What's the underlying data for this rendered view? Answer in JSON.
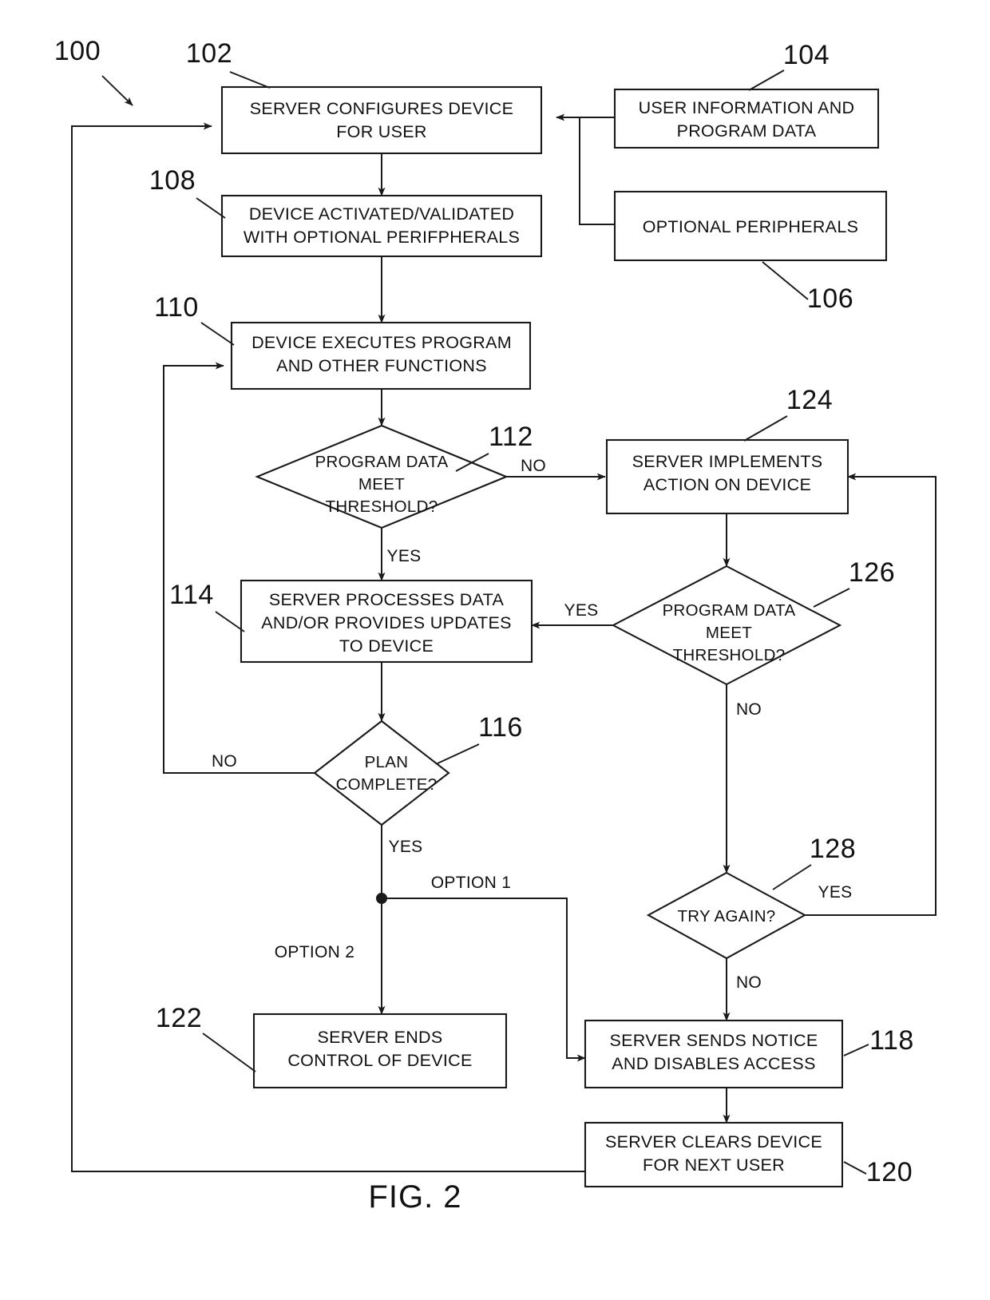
{
  "figure": {
    "caption": "FIG. 2",
    "system_ref": "100"
  },
  "nodes": [
    {
      "id": "102",
      "ref": "102",
      "type": "process",
      "lines": [
        "SERVER CONFIGURES DEVICE",
        "FOR USER"
      ]
    },
    {
      "id": "104",
      "ref": "104",
      "type": "process",
      "lines": [
        "USER INFORMATION AND",
        "PROGRAM DATA"
      ]
    },
    {
      "id": "106",
      "ref": "106",
      "type": "process",
      "lines": [
        "OPTIONAL PERIPHERALS"
      ]
    },
    {
      "id": "108",
      "ref": "108",
      "type": "process",
      "lines": [
        "DEVICE ACTIVATED/VALIDATED",
        "WITH OPTIONAL PERIFPHERALS"
      ]
    },
    {
      "id": "110",
      "ref": "110",
      "type": "process",
      "lines": [
        "DEVICE EXECUTES PROGRAM",
        "AND OTHER FUNCTIONS"
      ]
    },
    {
      "id": "112",
      "ref": "112",
      "type": "decision",
      "lines": [
        "PROGRAM DATA",
        "MEET",
        "THRESHOLD?"
      ]
    },
    {
      "id": "114",
      "ref": "114",
      "type": "process",
      "lines": [
        "SERVER PROCESSES DATA",
        "AND/OR PROVIDES UPDATES",
        "TO DEVICE"
      ]
    },
    {
      "id": "116",
      "ref": "116",
      "type": "decision",
      "lines": [
        "PLAN",
        "COMPLETE?"
      ]
    },
    {
      "id": "118",
      "ref": "118",
      "type": "process",
      "lines": [
        "SERVER SENDS NOTICE",
        "AND DISABLES ACCESS"
      ]
    },
    {
      "id": "120",
      "ref": "120",
      "type": "process",
      "lines": [
        "SERVER CLEARS DEVICE",
        "FOR NEXT USER"
      ]
    },
    {
      "id": "122",
      "ref": "122",
      "type": "process",
      "lines": [
        "SERVER ENDS",
        "CONTROL OF DEVICE"
      ]
    },
    {
      "id": "124",
      "ref": "124",
      "type": "process",
      "lines": [
        "SERVER IMPLEMENTS",
        "ACTION ON DEVICE"
      ]
    },
    {
      "id": "126",
      "ref": "126",
      "type": "decision",
      "lines": [
        "PROGRAM DATA",
        "MEET",
        "THRESHOLD?"
      ]
    },
    {
      "id": "128",
      "ref": "128",
      "type": "decision",
      "lines": [
        "TRY AGAIN?"
      ]
    }
  ],
  "edge_labels": {
    "e112_no": "NO",
    "e112_yes": "YES",
    "e116_no": "NO",
    "e116_yes": "YES",
    "e126_yes": "YES",
    "e126_no": "NO",
    "e128_yes": "YES",
    "e128_no": "NO",
    "option1": "OPTION 1",
    "option2": "OPTION 2"
  },
  "refs": {
    "r100": "100",
    "r102": "102",
    "r104": "104",
    "r106": "106",
    "r108": "108",
    "r110": "110",
    "r112": "112",
    "r114": "114",
    "r116": "116",
    "r118": "118",
    "r120": "120",
    "r122": "122",
    "r124": "124",
    "r126": "126",
    "r128": "128"
  },
  "colors": {
    "ink": "#1a1a1a",
    "paper": "#ffffff"
  }
}
